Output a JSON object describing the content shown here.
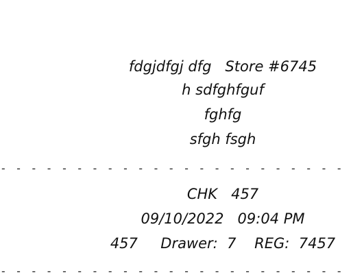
{
  "receipt": {
    "header": {
      "line1": "fdgjdfgj dfg   Store #6745",
      "line2": "h sdfghfguf",
      "line3": "fghfg",
      "line4": "sfgh fsgh"
    },
    "check": {
      "chk": "CHK   457",
      "datetime": "09/10/2022   09:04 PM",
      "drawer_reg": "457     Drawer:  7    REG:  7457"
    }
  }
}
